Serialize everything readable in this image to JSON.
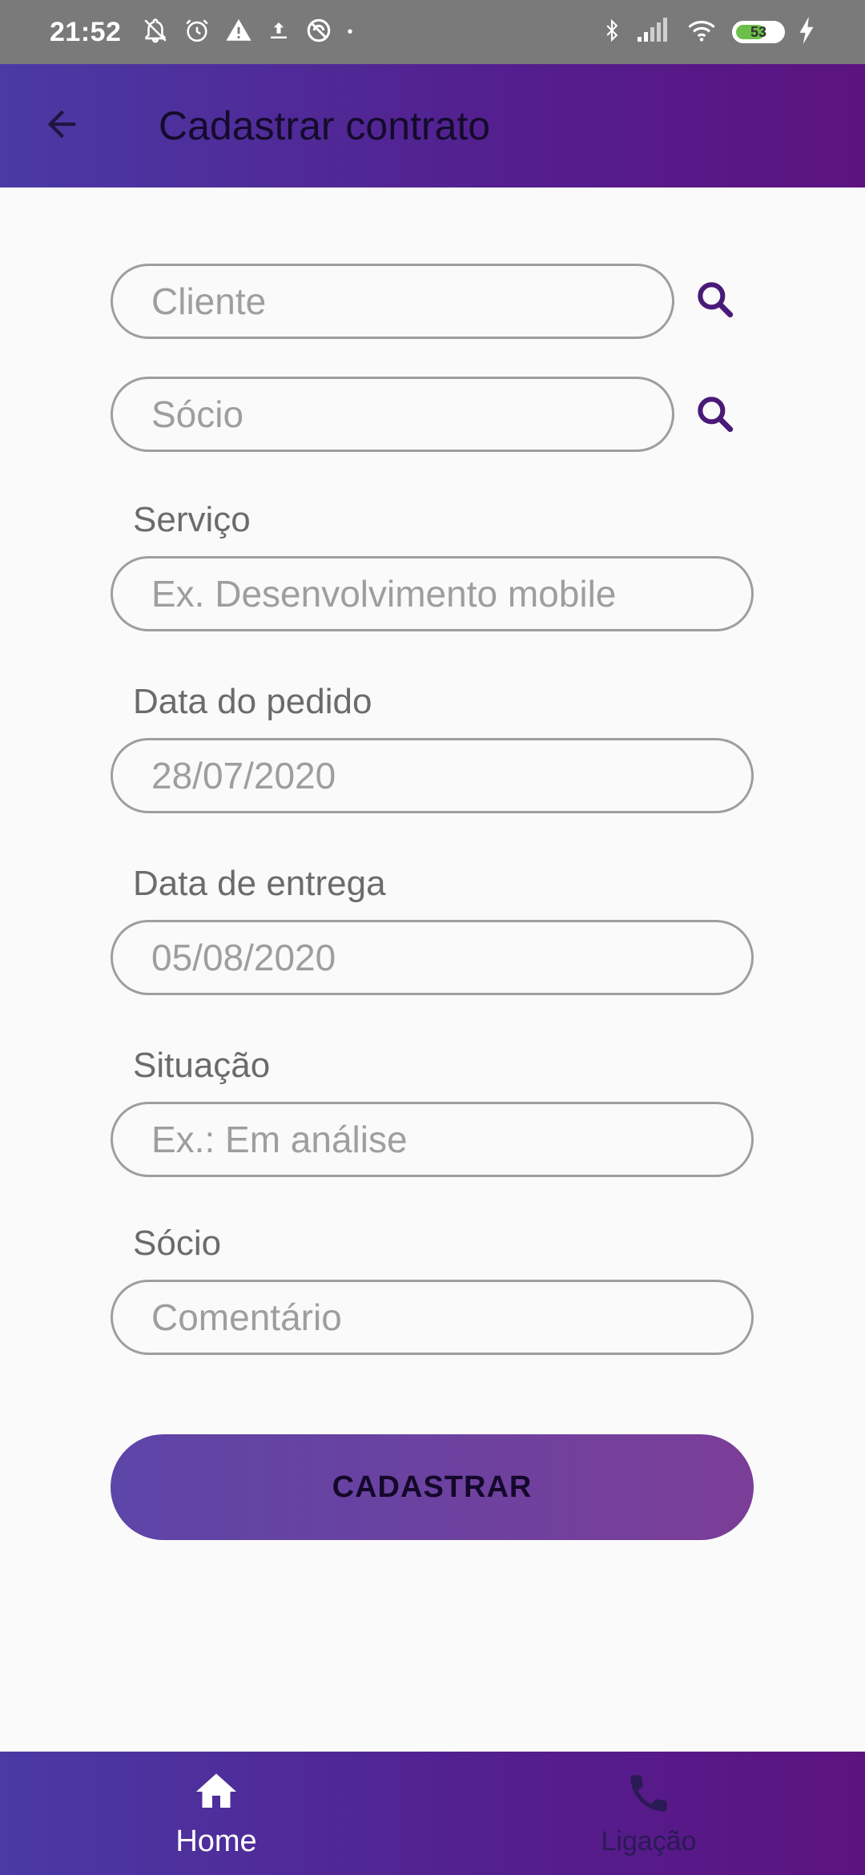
{
  "status_bar": {
    "time": "21:52",
    "battery": "53",
    "icons": [
      "bell-off-icon",
      "alarm-icon",
      "warning-icon",
      "upload-icon",
      "dnd-icon",
      "bluetooth-icon",
      "signal-icon",
      "wifi-icon",
      "battery-icon",
      "charging-icon"
    ]
  },
  "app_bar": {
    "title": "Cadastrar contrato",
    "back_icon": "arrow-left-icon"
  },
  "form": {
    "cliente_placeholder": "Cliente",
    "socio_placeholder": "Sócio",
    "servico_label": "Serviço",
    "servico_placeholder": "Ex. Desenvolvimento mobile",
    "data_pedido_label": "Data do pedido",
    "data_pedido_value": "28/07/2020",
    "data_entrega_label": "Data de entrega",
    "data_entrega_value": "05/08/2020",
    "situacao_label": "Situação",
    "situacao_placeholder": "Ex.: Em análise",
    "comentario_label": "Sócio",
    "comentario_placeholder": "Comentário",
    "submit_label": "CADASTRAR"
  },
  "bottom_nav": {
    "items": [
      {
        "label": "Home",
        "icon": "home-icon",
        "active": true
      },
      {
        "label": "Ligação",
        "icon": "phone-icon",
        "active": false
      }
    ]
  },
  "colors": {
    "primary_start": "#4a3aa5",
    "primary_end": "#5c1380",
    "search_icon": "#4a1a78",
    "field_border": "#9e9e9e"
  }
}
